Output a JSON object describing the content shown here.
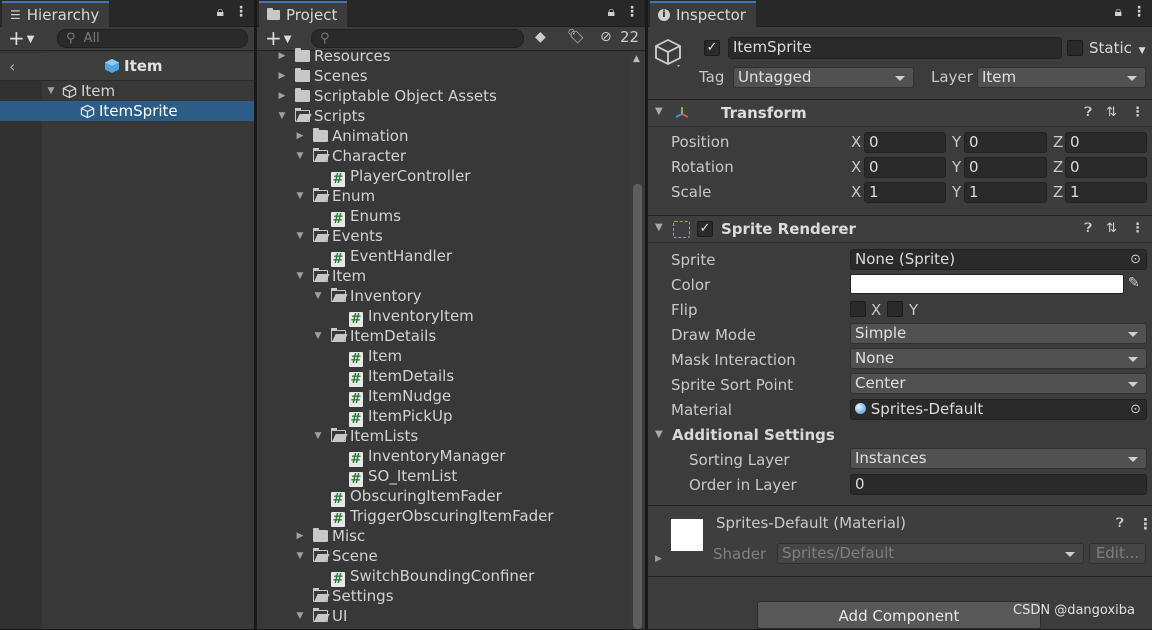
{
  "hierarchy": {
    "tab_label": "Hierarchy",
    "search_placeholder": "All",
    "scene_name": "Item",
    "items": [
      {
        "label": "Item"
      },
      {
        "label": "ItemSprite"
      }
    ]
  },
  "project": {
    "tab_label": "Project",
    "hidden_count": "22",
    "tree": [
      {
        "label": "Resources",
        "kind": "folder-closed",
        "depth": 0,
        "arrow": "right"
      },
      {
        "label": "Scenes",
        "kind": "folder-closed",
        "depth": 0,
        "arrow": "right"
      },
      {
        "label": "Scriptable Object Assets",
        "kind": "folder-closed",
        "depth": 0,
        "arrow": "right"
      },
      {
        "label": "Scripts",
        "kind": "folder-open",
        "depth": 0,
        "arrow": "down"
      },
      {
        "label": "Animation",
        "kind": "folder-closed",
        "depth": 1,
        "arrow": "right"
      },
      {
        "label": "Character",
        "kind": "folder-open",
        "depth": 1,
        "arrow": "down"
      },
      {
        "label": "PlayerController",
        "kind": "script",
        "depth": 2,
        "arrow": ""
      },
      {
        "label": "Enum",
        "kind": "folder-open",
        "depth": 1,
        "arrow": "down"
      },
      {
        "label": "Enums",
        "kind": "script",
        "depth": 2,
        "arrow": ""
      },
      {
        "label": "Events",
        "kind": "folder-open",
        "depth": 1,
        "arrow": "down"
      },
      {
        "label": "EventHandler",
        "kind": "script",
        "depth": 2,
        "arrow": ""
      },
      {
        "label": "Item",
        "kind": "folder-open",
        "depth": 1,
        "arrow": "down"
      },
      {
        "label": "Inventory",
        "kind": "folder-open",
        "depth": 2,
        "arrow": "down"
      },
      {
        "label": "InventoryItem",
        "kind": "script",
        "depth": 3,
        "arrow": ""
      },
      {
        "label": "ItemDetails",
        "kind": "folder-open",
        "depth": 2,
        "arrow": "down"
      },
      {
        "label": "Item",
        "kind": "script",
        "depth": 3,
        "arrow": ""
      },
      {
        "label": "ItemDetails",
        "kind": "script",
        "depth": 3,
        "arrow": ""
      },
      {
        "label": "ItemNudge",
        "kind": "script",
        "depth": 3,
        "arrow": ""
      },
      {
        "label": "ItemPickUp",
        "kind": "script",
        "depth": 3,
        "arrow": ""
      },
      {
        "label": "ItemLists",
        "kind": "folder-open",
        "depth": 2,
        "arrow": "down"
      },
      {
        "label": "InventoryManager",
        "kind": "script",
        "depth": 3,
        "arrow": ""
      },
      {
        "label": "SO_ItemList",
        "kind": "script",
        "depth": 3,
        "arrow": ""
      },
      {
        "label": "ObscuringItemFader",
        "kind": "script",
        "depth": 2,
        "arrow": ""
      },
      {
        "label": "TriggerObscuringItemFader",
        "kind": "script",
        "depth": 2,
        "arrow": ""
      },
      {
        "label": "Misc",
        "kind": "folder-closed",
        "depth": 1,
        "arrow": "right"
      },
      {
        "label": "Scene",
        "kind": "folder-open",
        "depth": 1,
        "arrow": "down"
      },
      {
        "label": "SwitchBoundingConfiner",
        "kind": "script",
        "depth": 2,
        "arrow": ""
      },
      {
        "label": "Settings",
        "kind": "folder-empty",
        "depth": 1,
        "arrow": ""
      },
      {
        "label": "UI",
        "kind": "folder-open",
        "depth": 1,
        "arrow": "down"
      }
    ]
  },
  "inspector": {
    "tab_label": "Inspector",
    "object_name": "ItemSprite",
    "static_label": "Static",
    "tag_label": "Tag",
    "tag_value": "Untagged",
    "layer_label": "Layer",
    "layer_value": "Item",
    "transform": {
      "title": "Transform",
      "rows": [
        {
          "label": "Position",
          "x": "0",
          "y": "0",
          "z": "0"
        },
        {
          "label": "Rotation",
          "x": "0",
          "y": "0",
          "z": "0"
        },
        {
          "label": "Scale",
          "x": "1",
          "y": "1",
          "z": "1"
        }
      ],
      "axis_x": "X",
      "axis_y": "Y",
      "axis_z": "Z"
    },
    "sprite_renderer": {
      "title": "Sprite Renderer",
      "sprite_label": "Sprite",
      "sprite_value": "None (Sprite)",
      "color_label": "Color",
      "color_value": "#ffffff",
      "flip_label": "Flip",
      "flip_x": "X",
      "flip_y": "Y",
      "draw_mode_label": "Draw Mode",
      "draw_mode_value": "Simple",
      "mask_label": "Mask Interaction",
      "mask_value": "None",
      "sort_point_label": "Sprite Sort Point",
      "sort_point_value": "Center",
      "material_label": "Material",
      "material_value": "Sprites-Default",
      "additional_label": "Additional Settings",
      "sorting_layer_label": "Sorting Layer",
      "sorting_layer_value": "Instances",
      "order_label": "Order in Layer",
      "order_value": "0"
    },
    "material": {
      "title": "Sprites-Default (Material)",
      "shader_label": "Shader",
      "shader_value": "Sprites/Default",
      "edit_label": "Edit..."
    },
    "add_component_label": "Add Component"
  },
  "watermark": "CSDN @dangoxiba",
  "colors": {
    "accent_tab": "#3a79bb",
    "selection": "#2c5d87"
  }
}
